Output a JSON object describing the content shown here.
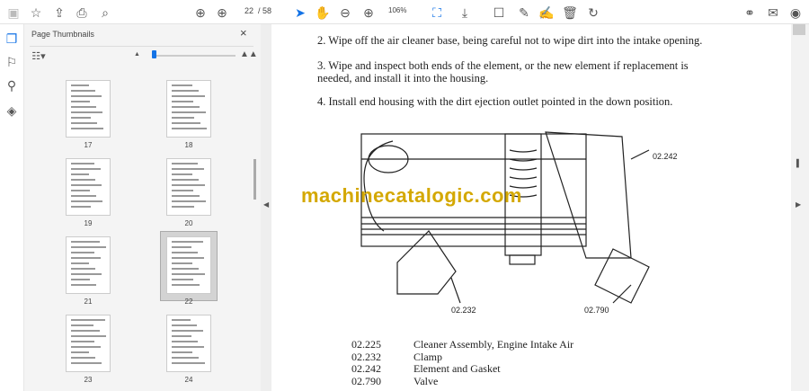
{
  "toolbar": {
    "page_current": "22",
    "page_total": "/ 58",
    "zoom": "106%"
  },
  "panel": {
    "title": "Page Thumbnails",
    "close": "×"
  },
  "thumbnails": [
    {
      "label": "17"
    },
    {
      "label": "18"
    },
    {
      "label": "19"
    },
    {
      "label": "20"
    },
    {
      "label": "21"
    },
    {
      "label": "22",
      "selected": true
    },
    {
      "label": "23"
    },
    {
      "label": "24"
    }
  ],
  "document": {
    "steps": [
      "2. Wipe off the air cleaner base, being careful not to wipe dirt into the intake opening.",
      "3. Wipe and inspect both ends of the element, or the new element if replacement is",
      "needed, and install it into the housing.",
      "4. Install end housing with the dirt ejection outlet pointed in the down position."
    ],
    "watermark": "machinecatalogic.com",
    "callouts": [
      "02.242",
      "02.232",
      "02.790"
    ],
    "parts": [
      {
        "code": "02.225",
        "desc": "Cleaner Assembly, Engine Intake Air"
      },
      {
        "code": "02.232",
        "desc": "Clamp"
      },
      {
        "code": "02.242",
        "desc": "Element and Gasket"
      },
      {
        "code": "02.790",
        "desc": "Valve"
      }
    ]
  }
}
